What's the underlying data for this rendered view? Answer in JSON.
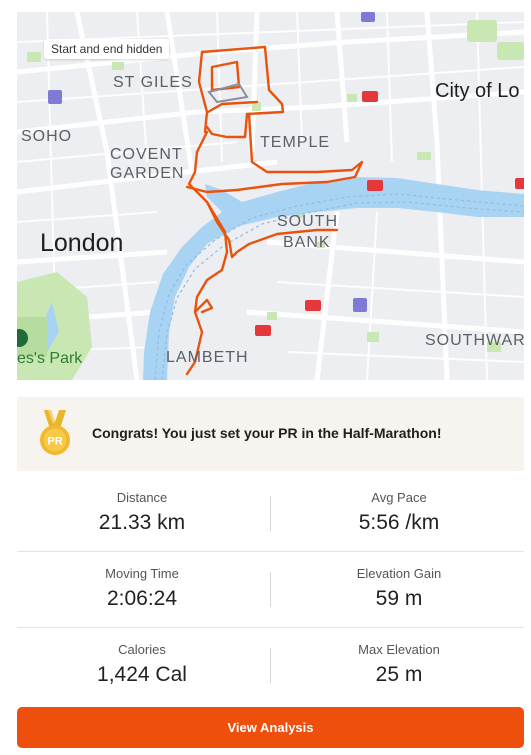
{
  "map": {
    "hidden_note": "Start and end hidden",
    "labels": {
      "st_giles": "ST GILES",
      "soho": "SOHO",
      "covent": "COVENT",
      "garden": "GARDEN",
      "temple": "TEMPLE",
      "city_of_london": "City of Lo",
      "london": "London",
      "south": "SOUTH",
      "bank": "BANK",
      "lambeth": "LAMBETH",
      "southwark": "SOUTHWAR",
      "park": "es's Park"
    },
    "route_color": "#e8530e",
    "water_color": "#a9d3f2",
    "park_color": "#c8e6b0"
  },
  "pr_banner": {
    "medal_text": "PR",
    "message": "Congrats! You just set your PR in the Half-Marathon!"
  },
  "stats": [
    {
      "left": {
        "label": "Distance",
        "value": "21.33 km"
      },
      "right": {
        "label": "Avg Pace",
        "value": "5:56 /km"
      }
    },
    {
      "left": {
        "label": "Moving Time",
        "value": "2:06:24"
      },
      "right": {
        "label": "Elevation Gain",
        "value": "59 m"
      }
    },
    {
      "left": {
        "label": "Calories",
        "value": "1,424 Cal"
      },
      "right": {
        "label": "Max Elevation",
        "value": "25 m"
      }
    }
  ],
  "actions": {
    "view_analysis": "View Analysis"
  }
}
